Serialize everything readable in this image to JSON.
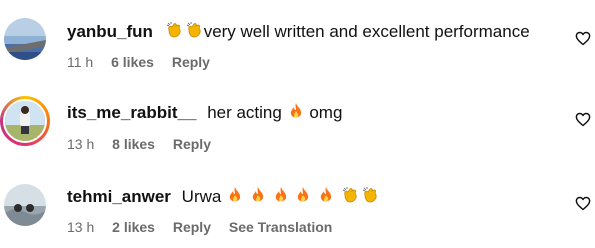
{
  "comments": [
    {
      "username": "yanbu_fun",
      "text": "very well written and excellent performance",
      "time": "11 h",
      "likes": "6 likes",
      "reply": "Reply"
    },
    {
      "username": "its_me_rabbit__",
      "text_before": "her acting",
      "text_after": "omg",
      "time": "13 h",
      "likes": "8 likes",
      "reply": "Reply"
    },
    {
      "username": "tehmi_anwer",
      "text": "Urwa",
      "time": "13 h",
      "likes": "2 likes",
      "reply": "Reply",
      "translate": "See Translation"
    }
  ],
  "icons": {
    "like": "heart-outline-icon",
    "clap": "clapping-hands-emoji",
    "fire": "fire-emoji"
  },
  "colors": {
    "text": "#111111",
    "meta": "#6b6b6b",
    "story_ring": "#e1306c",
    "fire": "#f97316",
    "clap": "#f5b400"
  }
}
